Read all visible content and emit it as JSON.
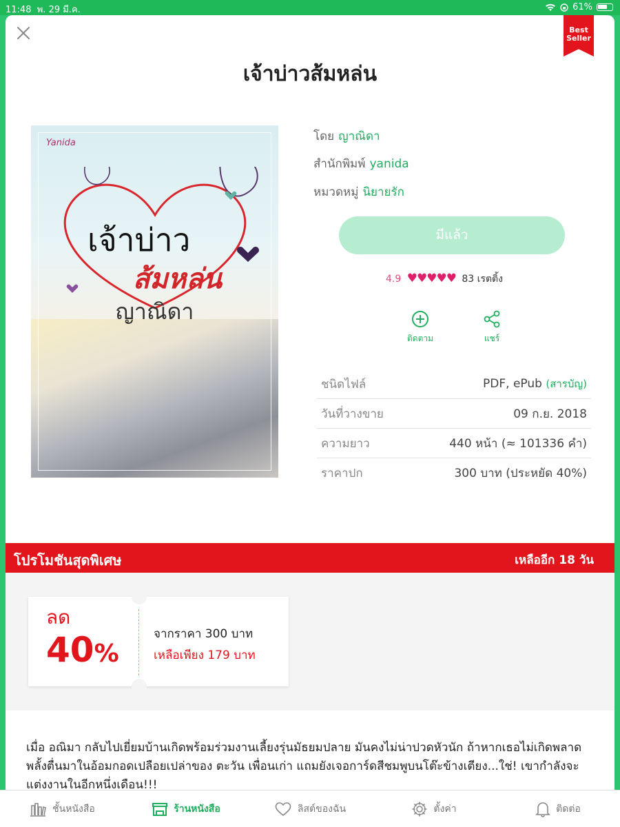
{
  "status": {
    "time": "11:48",
    "date": "พ. 29 มี.ค.",
    "battery": "61%"
  },
  "badge": "Best Seller",
  "book": {
    "title": "เจ้าบ่าวส้มหล่น",
    "by_label": "โดย",
    "author": "ญาณิดา",
    "publisher_label": "สำนักพิมพ์",
    "publisher": "yanida",
    "category_label": "หมวดหมู่",
    "category": "นิยายรัก",
    "cover": {
      "logo": "Yanida",
      "title_line1": "เจ้าบ่าว",
      "title_line2": "ส้มหล่น",
      "author": "ญาณิดา"
    }
  },
  "owned_button": "มีแล้ว",
  "rating": {
    "score": "4.9",
    "stars": 5,
    "count_label": "83 เรตติ้ง"
  },
  "actions": {
    "follow": "ติดตาม",
    "share": "แชร์"
  },
  "details": [
    {
      "key": "ชนิดไฟล์",
      "value": "PDF, ePub",
      "link": "(สารบัญ)"
    },
    {
      "key": "วันที่วางขาย",
      "value": "09 ก.ย. 2018",
      "link": ""
    },
    {
      "key": "ความยาว",
      "value": "440  หน้า (≈ 101336 คำ)",
      "link": ""
    },
    {
      "key": "ราคาปก",
      "value": "300 บาท (ประหยัด 40%)",
      "link": ""
    }
  ],
  "promo": {
    "title": "โปรโมชันสุดพิเศษ",
    "remaining": "เหลืออีก 18 วัน",
    "discount_label": "ลด",
    "discount_value": "40",
    "discount_unit": "%",
    "original_price": "จากราคา 300 บาท",
    "sale_price": "เหลือเพียง 179 บาท"
  },
  "description": "เมื่อ อณิมา กลับไปเยี่ยมบ้านเกิดพร้อมร่วมงานเลี้ยงรุ่นมัธยมปลาย มันคงไม่น่าปวดหัวนัก ถ้าหากเธอไม่เกิดพลาดพลั้งตื่นมาในอ้อมกอดเปลือยเปล่าของ ตะวัน เพื่อนเก่า แถมยังเจอการ์ดสีชมพูบนโต๊ะข้างเตียง...ใช่! เขากำลังจะแต่งงานในอีกหนึ่งเดือน!!!",
  "tabs": [
    {
      "label": "ชั้นหนังสือ",
      "icon": "bookshelf-icon",
      "active": false
    },
    {
      "label": "ร้านหนังสือ",
      "icon": "store-icon",
      "active": true
    },
    {
      "label": "ลิสต์ของฉัน",
      "icon": "heart-icon",
      "active": false
    },
    {
      "label": "ตั้งค่า",
      "icon": "gear-icon",
      "active": false
    },
    {
      "label": "ติดต่อ",
      "icon": "bell-icon",
      "active": false
    }
  ],
  "colors": {
    "accent": "#1fae5e",
    "promo": "#e3151c",
    "owned_button": "#b6ecd0",
    "stars": "#e01f6b"
  }
}
